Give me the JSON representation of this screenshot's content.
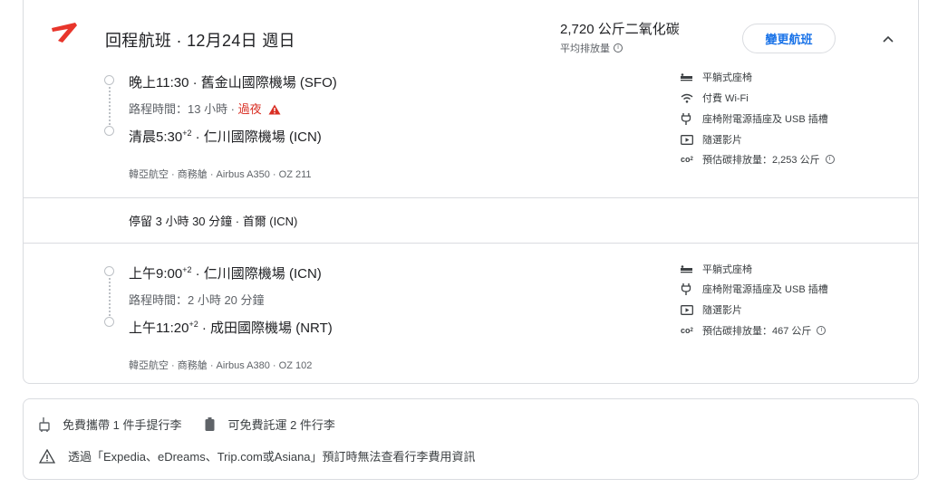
{
  "header": {
    "title": "回程航班 · 12月24日 週日",
    "co2_value": "2,720 公斤二氧化碳",
    "co2_label": "平均排放量",
    "change_button": "變更航班",
    "brand_color": "#e8352b"
  },
  "segments": [
    {
      "depart": "晚上11:30 · 舊金山國際機場 (SFO)",
      "duration": "路程時間：13 小時 · ",
      "overnight": "過夜",
      "arrive_time": "清晨5:30",
      "arrive_offset": "+2",
      "arrive_airport": " · 仁川國際機場 (ICN)",
      "airline": "韓亞航空 · 商務艙 · Airbus A350 · OZ 211",
      "amenities": [
        {
          "icon": "flat-seat-icon",
          "label": "平躺式座椅"
        },
        {
          "icon": "wifi-icon",
          "label": "付費 Wi-Fi"
        },
        {
          "icon": "power-plug-icon",
          "label": "座椅附電源插座及 USB 插槽"
        },
        {
          "icon": "video-icon",
          "label": "隨選影片"
        },
        {
          "icon": "co2-icon",
          "label": "預估碳排放量：2,253 公斤"
        }
      ]
    },
    {
      "depart_time": "上午9:00",
      "depart_offset": "+2",
      "depart_airport": " · 仁川國際機場 (ICN)",
      "duration": "路程時間：2 小時 20 分鐘",
      "arrive_time": "上午11:20",
      "arrive_offset": "+2",
      "arrive_airport": " · 成田國際機場 (NRT)",
      "airline": "韓亞航空 · 商務艙 · Airbus A380 · OZ 102",
      "amenities": [
        {
          "icon": "flat-seat-icon",
          "label": "平躺式座椅"
        },
        {
          "icon": "power-plug-icon",
          "label": "座椅附電源插座及 USB 插槽"
        },
        {
          "icon": "video-icon",
          "label": "隨選影片"
        },
        {
          "icon": "co2-icon",
          "label": "預估碳排放量：467 公斤"
        }
      ]
    }
  ],
  "layover": "停留 3 小時 30 分鐘 · 首爾 (ICN)",
  "baggage": {
    "carry_on": "免費攜帶 1 件手提行李",
    "checked": "可免費託運 2 件行李",
    "notice": "透過「Expedia、eDreams、Trip.com或Asiana」預訂時無法查看行李費用資訊"
  }
}
